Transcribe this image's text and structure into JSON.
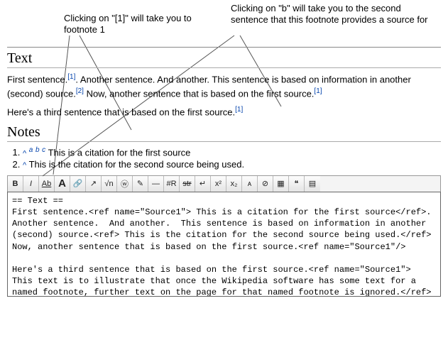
{
  "callouts": {
    "left": "Clicking on \"[1]\" will take you to footnote 1",
    "right": "Clicking on \"b\" will take you to the second sentence that this footnote provides a source for"
  },
  "heading_text": "Text",
  "heading_notes": "Notes",
  "text": {
    "s1": "First sentence.",
    "r1": "[1]",
    "s2": ". Another sentence. And another. This sentence is based on information in another (second) source.",
    "r2": "[2]",
    "s3": " Now, another sentence that is based on the first source.",
    "r3": "[1]",
    "s4": "Here's a third sentence that is based on the first source.",
    "r4": "[1]"
  },
  "notes": {
    "n1_caret": "^",
    "n1_a": "a",
    "n1_b": "b",
    "n1_c": "c",
    "n1_text": " This is a citation for the first source",
    "n2_caret": "^",
    "n2_text": " This is the citation for the second source being used."
  },
  "toolbar": {
    "bold": "B",
    "italic": "I",
    "underline": "Ab",
    "big_a": "A",
    "link_int": "🔗",
    "link_ext": "↗",
    "math": "√n",
    "nowiki": "ⓦ",
    "sig": "✎",
    "hr": "—",
    "redirect": "#R",
    "strike": "str",
    "enter": "↵",
    "sup": "x²",
    "sub": "x₂",
    "small": "ᴀ",
    "comment": "⊘",
    "gallery": "▦",
    "ref": "❝",
    "table": "▤"
  },
  "editor_value": "== Text ==\nFirst sentence.<ref name=\"Source1\"> This is a citation for the first source</ref>.  Another sentence.  And another.  This sentence is based on information in another (second) source.<ref> This is the citation for the second source being used.</ref> Now, another sentence that is based on the first source.<ref name=\"Source1\"/>\n\nHere's a third sentence that is based on the first source.<ref name=\"Source1\"> This text is to illustrate that once the Wikipedia software has some text for a named footnote, further text on the page for that named footnote is ignored.</ref>\n\n== Notes ==\n<references/>"
}
